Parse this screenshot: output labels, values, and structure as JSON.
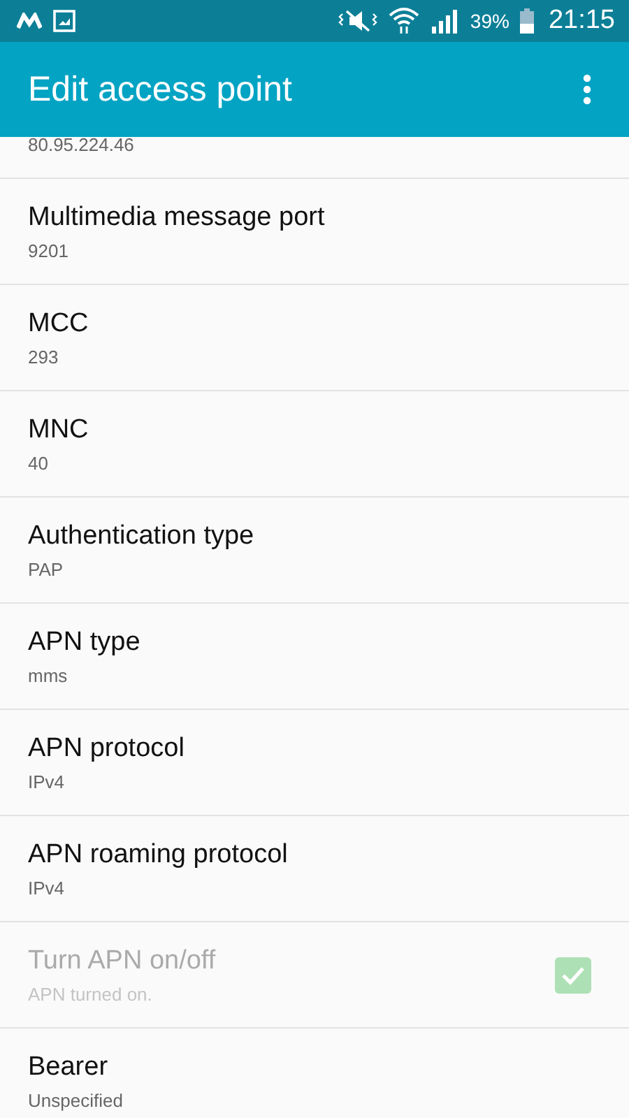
{
  "status_bar": {
    "battery": "39%",
    "time": "21:15"
  },
  "app_bar": {
    "title": "Edit access point"
  },
  "partial_value": "80.95.224.46",
  "items": [
    {
      "kind": "text",
      "title": "Multimedia message port",
      "value": "9201"
    },
    {
      "kind": "text",
      "title": "MCC",
      "value": "293"
    },
    {
      "kind": "text",
      "title": "MNC",
      "value": "40"
    },
    {
      "kind": "text",
      "title": "Authentication type",
      "value": "PAP"
    },
    {
      "kind": "text",
      "title": "APN type",
      "value": "mms"
    },
    {
      "kind": "text",
      "title": "APN protocol",
      "value": "IPv4"
    },
    {
      "kind": "text",
      "title": "APN roaming protocol",
      "value": "IPv4"
    },
    {
      "kind": "checkbox",
      "title": "Turn APN on/off",
      "value": "APN turned on.",
      "checked": true,
      "disabled": true
    },
    {
      "kind": "text",
      "title": "Bearer",
      "value": "Unspecified"
    }
  ]
}
